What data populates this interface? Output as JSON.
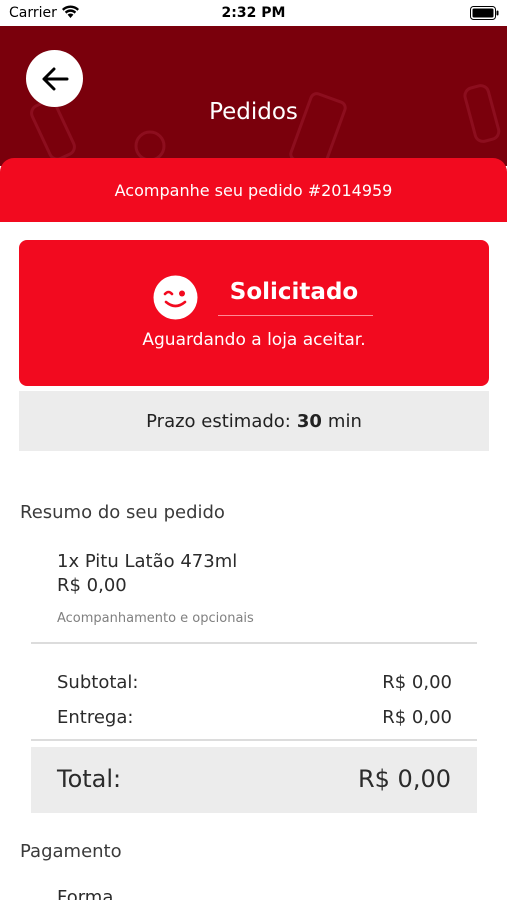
{
  "status_bar": {
    "carrier": "Carrier",
    "time": "2:32 PM"
  },
  "header": {
    "title": "Pedidos",
    "back_icon": "arrow-left-icon"
  },
  "banner": {
    "text": "Acompanhe seu pedido #2014959"
  },
  "order_status": {
    "icon": "wink-face-icon",
    "title": "Solicitado",
    "subtitle": "Aguardando a loja aceitar."
  },
  "eta": {
    "label": "Prazo estimado:",
    "value": "30",
    "unit": "min"
  },
  "summary": {
    "title": "Resumo do seu pedido",
    "items": [
      {
        "name": "1x Pitu Latão 473ml",
        "price": "R$ 0,00",
        "note": "Acompanhamento e opcionais"
      }
    ],
    "subtotal_label": "Subtotal:",
    "subtotal_value": "R$ 0,00",
    "delivery_label": "Entrega:",
    "delivery_value": "R$ 0,00",
    "total_label": "Total:",
    "total_value": "R$ 0,00"
  },
  "payment": {
    "title": "Pagamento",
    "method_label": "Forma"
  },
  "colors": {
    "header": "#7a000c",
    "accent": "#f20a1f",
    "panel": "#ececec"
  }
}
